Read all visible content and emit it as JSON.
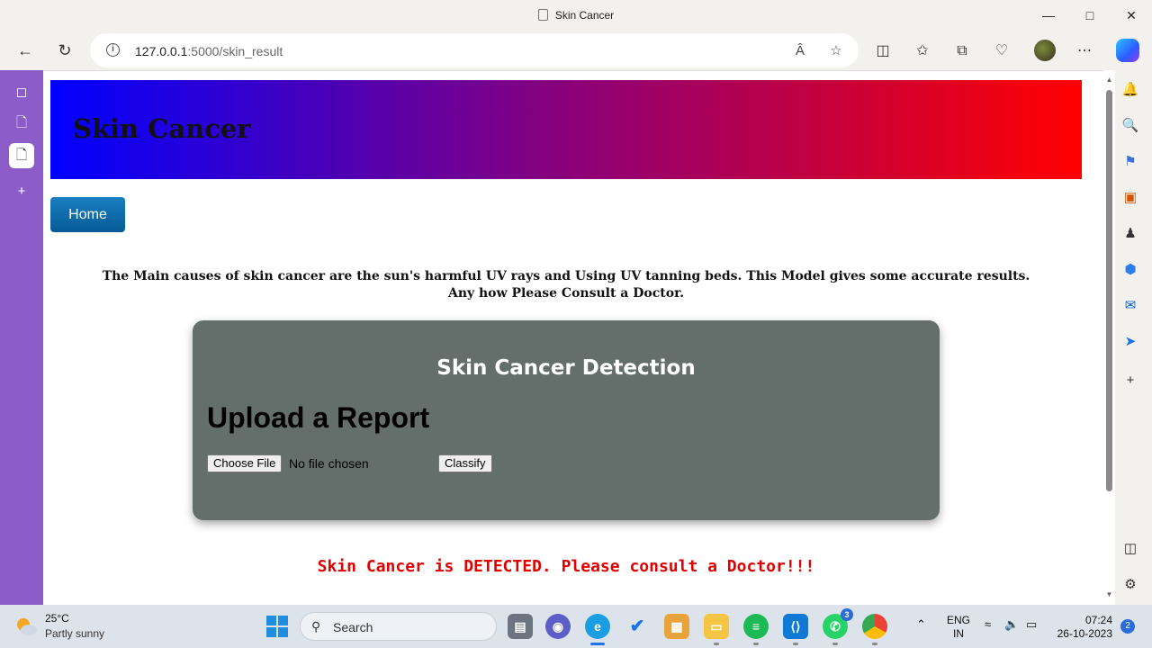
{
  "browser": {
    "tab_title": "Skin Cancer",
    "url_host": "127.0.0.1",
    "url_path": ":5000/skin_result"
  },
  "page": {
    "banner_title": "Skin Cancer",
    "home_label": "Home",
    "intro_line1": "The Main causes of skin cancer are the sun's harmful UV rays and Using UV tanning beds. This Model gives some accurate results.",
    "intro_line2": "Any how Please Consult a Doctor.",
    "card_title": "Skin Cancer Detection",
    "upload_heading": "Upload a Report",
    "choose_file_label": "Choose File",
    "no_file_text": "No file chosen",
    "classify_label": "Classify",
    "result_text": "Skin Cancer is DETECTED. Please consult a Doctor!!!"
  },
  "taskbar": {
    "weather_temp": "25°C",
    "weather_cond": "Partly sunny",
    "search_label": "Search",
    "whatsapp_badge": "3",
    "lang_line1": "ENG",
    "lang_line2": "IN",
    "time": "07:24",
    "date": "26-10-2023",
    "notification_count": "2"
  },
  "colors": {
    "banner_start": "#0000ff",
    "banner_end": "#ff0000",
    "card_bg": "#646f6b",
    "result_text": "#e00000",
    "home_button": "#0b6aa8",
    "tab_strip": "#8c5cc9"
  }
}
